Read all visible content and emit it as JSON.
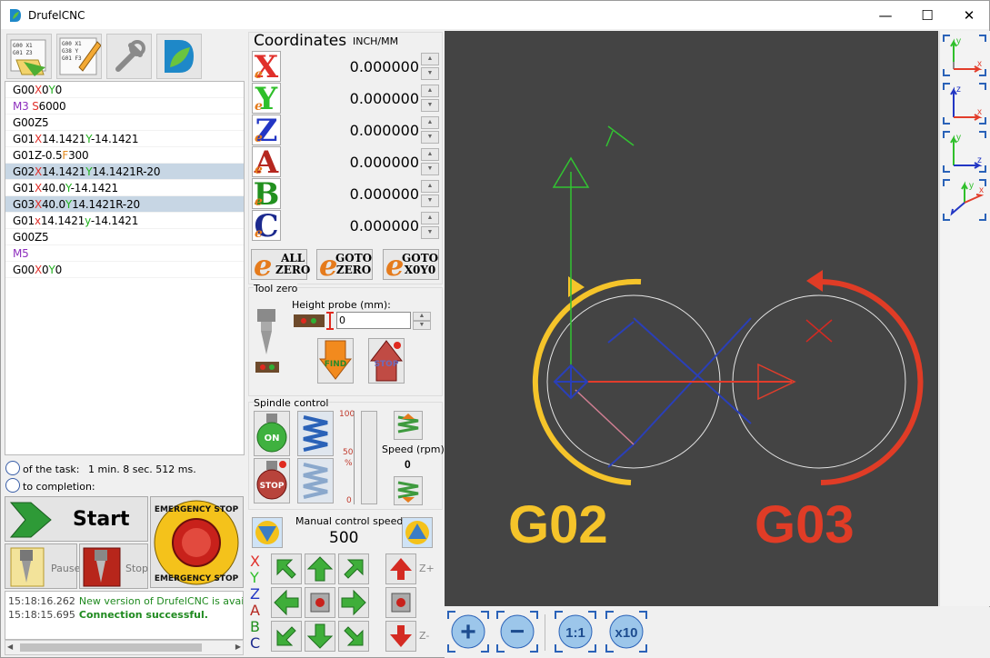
{
  "window": {
    "title": "DrufelCNC",
    "minimize": "—",
    "maximize": "☐",
    "close": "✕"
  },
  "code_lines": [
    {
      "parts": [
        [
          "G00",
          "#000"
        ],
        [
          "X",
          "#e0302b"
        ],
        [
          "0",
          "#000"
        ],
        [
          "Y",
          "#21b21e"
        ],
        [
          "0",
          "#000"
        ]
      ],
      "selected": false
    },
    {
      "parts": [
        [
          "M3",
          "#8e2fbe"
        ],
        [
          " ",
          "#000"
        ],
        [
          "S",
          "#e0302b"
        ],
        [
          "6000",
          "#000"
        ]
      ],
      "selected": false
    },
    {
      "parts": [
        [
          "G00",
          "#000"
        ],
        [
          "Z5",
          "#000"
        ]
      ],
      "selected": false
    },
    {
      "parts": [
        [
          "G01",
          "#000"
        ],
        [
          "X",
          "#e0302b"
        ],
        [
          "14.1421",
          "#000"
        ],
        [
          "Y",
          "#21b21e"
        ],
        [
          "-14.1421",
          "#000"
        ]
      ],
      "selected": false
    },
    {
      "parts": [
        [
          "G01",
          "#000"
        ],
        [
          "Z-0.5",
          "#000"
        ],
        [
          "F",
          "#e58a1d"
        ],
        [
          "300",
          "#000"
        ]
      ],
      "selected": false
    },
    {
      "parts": [
        [
          "G02",
          "#000"
        ],
        [
          "X",
          "#e0302b"
        ],
        [
          "14.1421",
          "#000"
        ],
        [
          "Y",
          "#21b21e"
        ],
        [
          "14.1421R-20",
          "#000"
        ]
      ],
      "selected": true
    },
    {
      "parts": [
        [
          "G01",
          "#000"
        ],
        [
          "X",
          "#e0302b"
        ],
        [
          "40.0",
          "#000"
        ],
        [
          "Y",
          "#21b21e"
        ],
        [
          "-14.1421",
          "#000"
        ]
      ],
      "selected": false
    },
    {
      "parts": [
        [
          "G03",
          "#000"
        ],
        [
          "X",
          "#e0302b"
        ],
        [
          "40.0",
          "#000"
        ],
        [
          "Y",
          "#21b21e"
        ],
        [
          "14.1421R-20",
          "#000"
        ]
      ],
      "selected": true
    },
    {
      "parts": [
        [
          "G01",
          "#000"
        ],
        [
          "x",
          "#e0302b"
        ],
        [
          "14.1421",
          "#000"
        ],
        [
          "y",
          "#21b21e"
        ],
        [
          "-14.1421",
          "#000"
        ]
      ],
      "selected": false
    },
    {
      "parts": [
        [
          "G00",
          "#000"
        ],
        [
          "Z5",
          "#000"
        ]
      ],
      "selected": false
    },
    {
      "parts": [
        [
          "M5",
          "#8e2fbe"
        ]
      ],
      "selected": false
    },
    {
      "parts": [
        [
          "G00",
          "#000"
        ],
        [
          "X",
          "#e0302b"
        ],
        [
          "0",
          "#000"
        ],
        [
          "Y",
          "#21b21e"
        ],
        [
          "0",
          "#000"
        ]
      ],
      "selected": false
    }
  ],
  "task": {
    "of_task_label": "of the task:",
    "time": "1 min. 8 sec. 512 ms.",
    "to_completion_label": "to completion:"
  },
  "controls": {
    "start": "Start",
    "pause": "Pause",
    "stop": "Stop",
    "emergency_top": "EMERGENCY STOP",
    "emergency_bottom": "EMERGENCY STOP"
  },
  "log": [
    {
      "time": "15:18:16.262",
      "text": "New version of DrufelCNC is available! !",
      "bold": false
    },
    {
      "time": "15:18:15.695",
      "text": "Connection successful.",
      "bold": true
    }
  ],
  "coords": {
    "title": "Coordinates",
    "units": "INCH/MM",
    "axes": [
      {
        "letter": "X",
        "color": "#e0302b",
        "value": "0.000000"
      },
      {
        "letter": "Y",
        "color": "#2fbf2a",
        "value": "0.000000"
      },
      {
        "letter": "Z",
        "color": "#2236c4",
        "value": "0.000000"
      },
      {
        "letter": "A",
        "color": "#b5271f",
        "value": "0.000000"
      },
      {
        "letter": "B",
        "color": "#21901e",
        "value": "0.000000"
      },
      {
        "letter": "C",
        "color": "#1c2a8e",
        "value": "0.000000"
      }
    ],
    "all_zero": "ALL ZERO",
    "goto_zero": "GOTO ZERO",
    "goto_x0y0": "GOTO X0Y0"
  },
  "tool_zero": {
    "title": "Tool zero",
    "height_probe_label": "Height probe (mm):",
    "height_probe_value": "0",
    "find": "FIND",
    "stop": "STOP"
  },
  "spindle": {
    "title": "Spindle control",
    "on": "ON",
    "stop": "STOP",
    "scale_top": "100",
    "scale_mid": "50",
    "scale_pct": "%",
    "scale_bottom": "0",
    "speed_label": "Speed (rpm)",
    "speed_value": "0"
  },
  "manual": {
    "label": "Manual control speed",
    "value": "500",
    "axis_labels": [
      "X",
      "Y",
      "Z",
      "A",
      "B",
      "C"
    ],
    "zplus": "Z+",
    "zminus": "Z-"
  },
  "canvas": {
    "g02": "G02",
    "g03": "G03",
    "g02_color": "#f5c42a",
    "g03_color": "#e03c26",
    "y_label": "Y"
  },
  "views": [
    {
      "a": "y",
      "b": "x"
    },
    {
      "a": "z",
      "b": "x"
    },
    {
      "a": "y",
      "b": "z"
    },
    {
      "a": "y",
      "b": "x"
    }
  ],
  "zoom": {
    "plus": "+",
    "minus": "−",
    "one": "1:1",
    "ten": "x10"
  }
}
